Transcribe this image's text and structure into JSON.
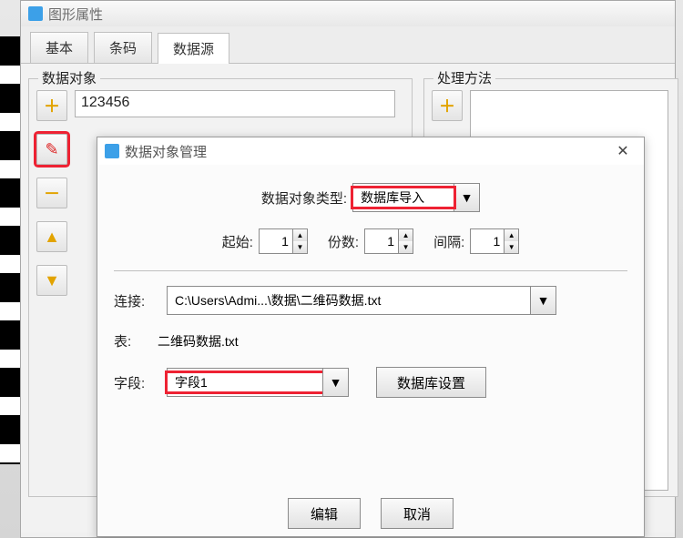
{
  "main": {
    "title": "图形属性"
  },
  "tabs": {
    "basic": "基本",
    "barcode": "条码",
    "datasource": "数据源"
  },
  "group": {
    "data_label": "数据对象",
    "process_label": "处理方法"
  },
  "data_value": "123456",
  "sidebar_icons": {
    "add": "plus-icon",
    "edit": "pencil-icon",
    "remove": "minus-icon",
    "up": "arrow-up-icon",
    "down": "arrow-down-icon"
  },
  "modal": {
    "title": "数据对象管理",
    "type_label": "数据对象类型:",
    "type_value": "数据库导入",
    "start_label": "起始:",
    "start_value": "1",
    "count_label": "份数:",
    "count_value": "1",
    "interval_label": "间隔:",
    "interval_value": "1",
    "connection_label": "连接:",
    "connection_value": "C:\\Users\\Admi...\\数据\\二维码数据.txt",
    "table_label": "表:",
    "table_value": "二维码数据.txt",
    "field_label": "字段:",
    "field_value": "字段1",
    "db_settings_btn": "数据库设置",
    "edit_btn": "编辑",
    "cancel_btn": "取消"
  }
}
